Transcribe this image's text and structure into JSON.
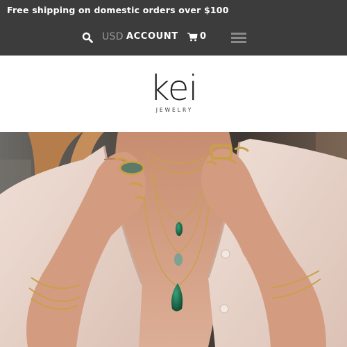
{
  "announcement": "Free shipping on domestic orders over $100",
  "nav": {
    "search_icon": "search-icon",
    "currency": "USD",
    "account": "ACCOUNT",
    "cart_icon": "cart-icon",
    "cart_count": "0",
    "menu_icon": "hamburger-menu-icon"
  },
  "logo": {
    "word": "kei",
    "sub": "JEWELRY"
  },
  "hero": {
    "description_icon": "hero-photo",
    "colors": {
      "skin": "#d9a184",
      "shirt": "#ead6cd",
      "background": "#5a5048",
      "gold": "#c9a04a",
      "stone": "#1f6a4a"
    }
  }
}
